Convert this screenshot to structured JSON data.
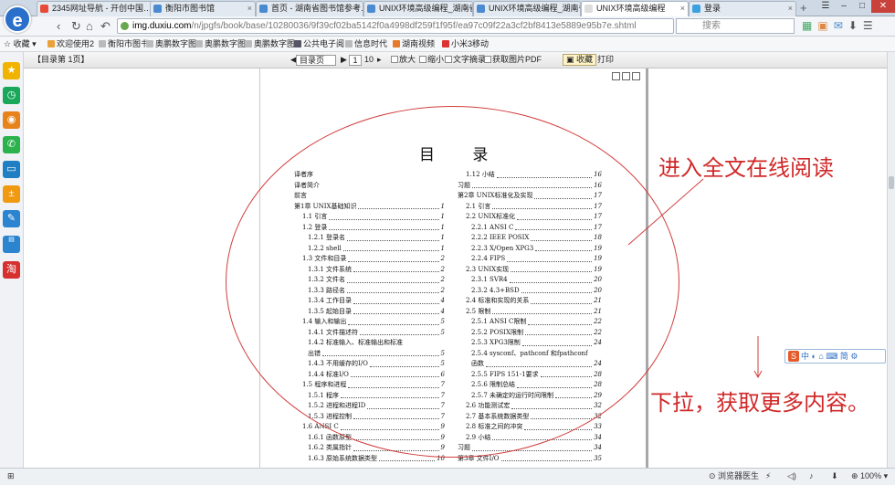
{
  "tabs": [
    {
      "label": "2345网址导航 - 开创中国…",
      "active": false
    },
    {
      "label": "衡阳市图书馆",
      "active": false
    },
    {
      "label": "首页 - 湖南省图书馆参考…",
      "active": false
    },
    {
      "label": "UNIX环境高级编程_湖南省…",
      "active": false
    },
    {
      "label": "UNIX环境高级编程_湖南省…",
      "active": false
    },
    {
      "label": "UNIX环境高级编程",
      "active": true
    },
    {
      "label": "登录",
      "active": false
    }
  ],
  "nav": {
    "logo": "e",
    "url_host": "img.duxiu.com",
    "url_rest": "/n/jpgfs/book/base/10280036/9f39cf02ba5142f0a4998df259f1f95f/ea97c09f22a3cf2bf8413e5889e95b7e.shtml",
    "search_placeholder": "搜索"
  },
  "favorites": {
    "label": "收藏",
    "items": [
      "欢迎使用2",
      "衡阳市图书",
      "奥鹏数字图",
      "奥鹏数字图",
      "奥鹏数字图",
      "公共电子阅",
      "信息时代",
      "湖南视频",
      "小米3移动"
    ]
  },
  "sidebar_icons": [
    "star-icon",
    "clock-icon",
    "weibo-icon",
    "wechat-icon",
    "tv-icon",
    "calc-icon",
    "notes-icon",
    "desktop-icon",
    "taobao-icon"
  ],
  "reader_toolbar": {
    "catalog_page": "【目录第 1页】",
    "view_select": "目录页",
    "page_number": "1",
    "page_total": "10",
    "zoom_in": "放大",
    "zoom_out": "缩小",
    "text_extract": "文字摘录",
    "get_image": "获取图片",
    "pdf": "PDF",
    "collect": "收藏",
    "print": "打印"
  },
  "toc": {
    "title": "目 录",
    "left": [
      {
        "label": "译者序",
        "page": "",
        "level": 1
      },
      {
        "label": "译者简介",
        "page": "",
        "level": 1
      },
      {
        "label": "前言",
        "page": "",
        "level": 1
      },
      {
        "label": "第1章 UNIX基础知识",
        "page": "1",
        "level": 1
      },
      {
        "label": "1.1 引言",
        "page": "1",
        "level": 2
      },
      {
        "label": "1.2 登录",
        "page": "1",
        "level": 2
      },
      {
        "label": "1.2.1 登录名",
        "page": "1",
        "level": 3
      },
      {
        "label": "1.2.2 shell",
        "page": "1",
        "level": 3
      },
      {
        "label": "1.3 文件和目录",
        "page": "2",
        "level": 2
      },
      {
        "label": "1.3.1 文件系统",
        "page": "2",
        "level": 3
      },
      {
        "label": "1.3.2 文件名",
        "page": "2",
        "level": 3
      },
      {
        "label": "1.3.3 路径名",
        "page": "2",
        "level": 3
      },
      {
        "label": "1.3.4 工作目录",
        "page": "4",
        "level": 3
      },
      {
        "label": "1.3.5 起始目录",
        "page": "4",
        "level": 3
      },
      {
        "label": "1.4 输入和输出",
        "page": "5",
        "level": 2
      },
      {
        "label": "1.4.1 文件描述符",
        "page": "5",
        "level": 3
      },
      {
        "label": "1.4.2 标准输入、标准输出和标准",
        "page": "",
        "level": 3
      },
      {
        "label": "出错",
        "page": "5",
        "level": 3
      },
      {
        "label": "1.4.3 不用缓存的I/O",
        "page": "5",
        "level": 3
      },
      {
        "label": "1.4.4 标准I/O",
        "page": "6",
        "level": 3
      },
      {
        "label": "1.5 程序和进程",
        "page": "7",
        "level": 2
      },
      {
        "label": "1.5.1 程序",
        "page": "7",
        "level": 3
      },
      {
        "label": "1.5.2 进程和进程ID",
        "page": "7",
        "level": 3
      },
      {
        "label": "1.5.3 进程控制",
        "page": "7",
        "level": 3
      },
      {
        "label": "1.6 ANSI C",
        "page": "9",
        "level": 2
      },
      {
        "label": "1.6.1 函数原型",
        "page": "9",
        "level": 3
      },
      {
        "label": "1.6.2 类属指针",
        "page": "9",
        "level": 3
      },
      {
        "label": "1.6.3 原始系统数据类型",
        "page": "10",
        "level": 3
      }
    ],
    "right": [
      {
        "label": "1.12 小结",
        "page": "16",
        "level": 2
      },
      {
        "label": "习题",
        "page": "16",
        "level": 1
      },
      {
        "label": "第2章 UNIX标准化及实现",
        "page": "17",
        "level": 1
      },
      {
        "label": "2.1 引言",
        "page": "17",
        "level": 2
      },
      {
        "label": "2.2 UNIX标准化",
        "page": "17",
        "level": 2
      },
      {
        "label": "2.2.1 ANSI C",
        "page": "17",
        "level": 3
      },
      {
        "label": "2.2.2 IEEE POSIX",
        "page": "18",
        "level": 3
      },
      {
        "label": "2.2.3 X/Open XPG3",
        "page": "19",
        "level": 3
      },
      {
        "label": "2.2.4 FIPS",
        "page": "19",
        "level": 3
      },
      {
        "label": "2.3 UNIX实现",
        "page": "19",
        "level": 2
      },
      {
        "label": "2.3.1 SVR4",
        "page": "20",
        "level": 3
      },
      {
        "label": "2.3.2 4.3+BSD",
        "page": "20",
        "level": 3
      },
      {
        "label": "2.4 标准和实现的关系",
        "page": "21",
        "level": 2
      },
      {
        "label": "2.5 限制",
        "page": "21",
        "level": 2
      },
      {
        "label": "2.5.1 ANSI C限制",
        "page": "22",
        "level": 3
      },
      {
        "label": "2.5.2 POSIX限制",
        "page": "22",
        "level": 3
      },
      {
        "label": "2.5.3 XPG3限制",
        "page": "24",
        "level": 3
      },
      {
        "label": "2.5.4 sysconf、pathconf 和fpathconf",
        "page": "",
        "level": 3
      },
      {
        "label": "函数",
        "page": "24",
        "level": 3
      },
      {
        "label": "2.5.5 FIPS 151-1要求",
        "page": "28",
        "level": 3
      },
      {
        "label": "2.5.6 限制总结",
        "page": "28",
        "level": 3
      },
      {
        "label": "2.5.7 未确定的运行时间限制",
        "page": "29",
        "level": 3
      },
      {
        "label": "2.6 功能测试宏",
        "page": "32",
        "level": 2
      },
      {
        "label": "2.7 基本系统数据类型",
        "page": "32",
        "level": 2
      },
      {
        "label": "2.8 标准之间的冲突",
        "page": "33",
        "level": 2
      },
      {
        "label": "2.9 小结",
        "page": "34",
        "level": 2
      },
      {
        "label": "习题",
        "page": "34",
        "level": 1
      },
      {
        "label": "第3章 文件I/O",
        "page": "35",
        "level": 1
      }
    ]
  },
  "annotations": {
    "top": "进入全文在线阅读",
    "bottom": "下拉，获取更多内容。",
    "color": "#d02828"
  },
  "ime": {
    "label": "中",
    "items": "中 ◐ ⌂ ⌨ 简 ⚙"
  },
  "status": {
    "doctor": "浏览器医生",
    "zoom": "100%"
  }
}
